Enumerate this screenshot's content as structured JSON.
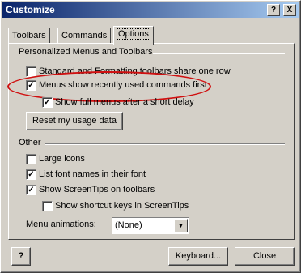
{
  "window": {
    "title": "Customize",
    "help_glyph": "?",
    "close_glyph": "X"
  },
  "tabs": [
    {
      "label": "Toolbars",
      "active": false
    },
    {
      "label": "Commands",
      "active": false
    },
    {
      "label": "Options",
      "active": true
    }
  ],
  "personalized": {
    "heading": "Personalized Menus and Toolbars",
    "items": [
      {
        "label": "Standard and Formatting toolbars share one row",
        "checked": false
      },
      {
        "label": "Menus show recently used commands first",
        "checked": true
      },
      {
        "label": "Show full menus after a short delay",
        "checked": true
      }
    ],
    "reset_button": "Reset my usage data"
  },
  "other": {
    "heading": "Other",
    "items": [
      {
        "label": "Large icons",
        "checked": false
      },
      {
        "label": "List font names in their font",
        "checked": true
      },
      {
        "label": "Show ScreenTips on toolbars",
        "checked": true
      },
      {
        "label": "Show shortcut keys in ScreenTips",
        "checked": false
      }
    ],
    "animations_label": "Menu animations:",
    "animations_value": "(None)"
  },
  "footer": {
    "help_glyph": "?",
    "keyboard_button": "Keyboard...",
    "close_button": "Close"
  },
  "colors": {
    "title_start": "#0a246a",
    "title_end": "#a6caf0",
    "highlight_oval": "#d01010"
  }
}
